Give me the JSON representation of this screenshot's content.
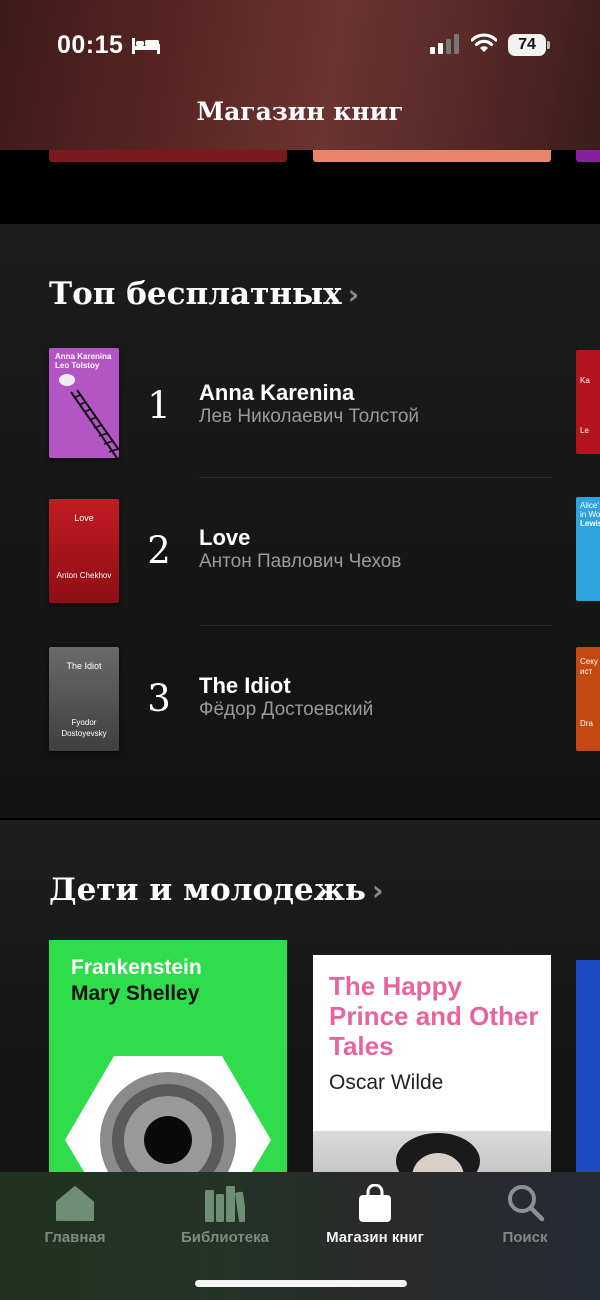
{
  "status_bar": {
    "time": "00:15",
    "battery": "74"
  },
  "header": {
    "title": "Магазин книг"
  },
  "top_free": {
    "title": "Топ бесплатных",
    "chevron": "›",
    "items": [
      {
        "rank": "1",
        "title": "Anna Karenina",
        "author": "Лев Николаевич Толстой",
        "cover_title": "Anna Karenina",
        "cover_author": "Leo Tolstoy",
        "cover_color": "#b455c5"
      },
      {
        "rank": "2",
        "title": "Love",
        "author": "Антон Павлович Чехов",
        "cover_title": "Love",
        "cover_author": "Anton Chekhov",
        "cover_color": "#b3151d"
      },
      {
        "rank": "3",
        "title": "The Idiot",
        "author": "Фёдор Достоевский",
        "cover_title": "The Idiot",
        "cover_author": "Fyodor Dostoyevsky",
        "cover_color": "#5e5e5e"
      }
    ],
    "edge_covers": [
      {
        "text1": "Ka",
        "text2": "Le",
        "color": "#b3151d"
      },
      {
        "text1": "Alice'",
        "text2": "in Wo",
        "text3": "Lewis",
        "color": "#2ea3de"
      },
      {
        "text1": "Секу",
        "text2": "ист",
        "text3": "Dra",
        "color": "#c24a12"
      }
    ]
  },
  "kids": {
    "title": "Дети и молодежь",
    "chevron": "›",
    "books": [
      {
        "title": "Frankenstein",
        "author": "Mary Shelley",
        "color": "#2fdc4b"
      },
      {
        "title": "The Happy Prince and Other Tales",
        "author": "Oscar Wilde",
        "title_color": "#e7659f"
      }
    ]
  },
  "tab_bar": {
    "tabs": [
      {
        "label": "Главная",
        "icon": "home-icon"
      },
      {
        "label": "Библиотека",
        "icon": "library-icon"
      },
      {
        "label": "Магазин книг",
        "icon": "bag-icon",
        "active": true
      },
      {
        "label": "Поиск",
        "icon": "search-icon"
      }
    ]
  }
}
